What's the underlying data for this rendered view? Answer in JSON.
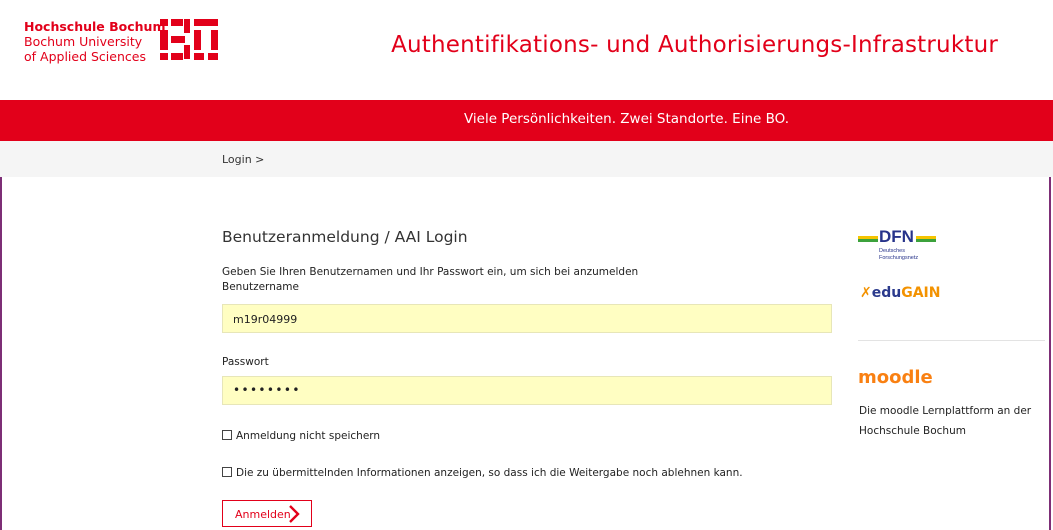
{
  "header": {
    "university_line1": "Hochschule Bochum",
    "university_line2": "Bochum University",
    "university_line3": "of Applied Sciences",
    "logo_text": "BO",
    "site_title": "Authentifikations- und Authorisierungs-Infrastruktur"
  },
  "banner": {
    "slogan": "Viele Persönlichkeiten. Zwei Standorte. Eine BO."
  },
  "breadcrumb": {
    "text": "Login >"
  },
  "login": {
    "heading": "Benutzeranmeldung / AAI Login",
    "intro": "Geben Sie Ihren Benutzernamen und Ihr Passwort ein, um sich bei anzumelden",
    "username_label": "Benutzername",
    "username_value": "m19r04999",
    "password_label": "Passwort",
    "password_value": "••••••••",
    "checkbox_dont_save": "Anmeldung nicht speichern",
    "checkbox_show_info": "Die zu übermittelnden Informationen anzeigen, so dass ich die Weitergabe noch ablehnen kann.",
    "submit_label": "Anmelden"
  },
  "sidebar": {
    "dfn_logo_text": "DFN",
    "dfn_subtitle_line1": "Deutsches",
    "dfn_subtitle_line2": "Forschungsnetz",
    "edugain_edu": "edu",
    "edugain_gain": "GAIN",
    "moodle_logo_text": "moodle",
    "moodle_description": "Die moodle Lernplattform an der Hochschule Bochum"
  },
  "colors": {
    "brand_red": "#e2001a",
    "frame_purple": "#7d2e76",
    "input_yellow": "#fffec2"
  }
}
